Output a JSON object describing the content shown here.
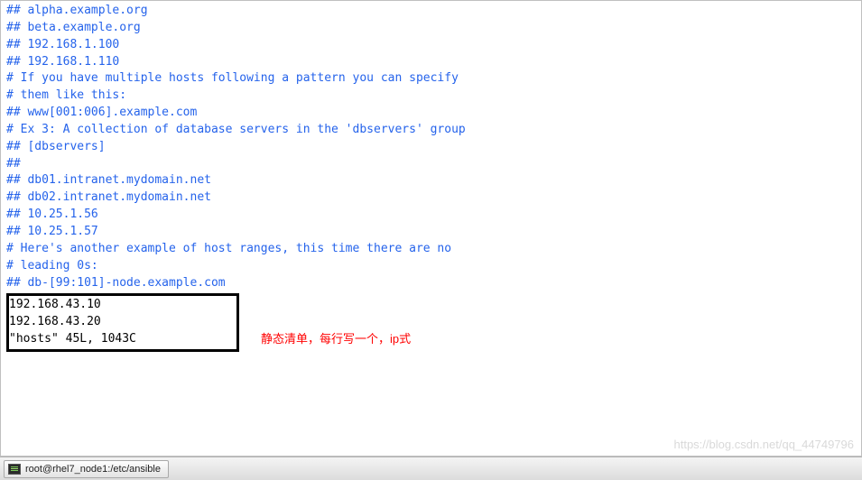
{
  "file_lines": [
    "## alpha.example.org",
    "## beta.example.org",
    "## 192.168.1.100",
    "## 192.168.1.110",
    "",
    "# If you have multiple hosts following a pattern you can specify",
    "# them like this:",
    "",
    "## www[001:006].example.com",
    "",
    "# Ex 3: A collection of database servers in the 'dbservers' group",
    "",
    "## [dbservers]",
    "##",
    "## db01.intranet.mydomain.net",
    "## db02.intranet.mydomain.net",
    "## 10.25.1.56",
    "## 10.25.1.57",
    "",
    "# Here's another example of host ranges, this time there are no",
    "# leading 0s:",
    "",
    "## db-[99:101]-node.example.com"
  ],
  "appended_lines": [
    "192.168.43.10",
    "192.168.43.20"
  ],
  "vim_status": "\"hosts\" 45L, 1043C",
  "annotation": "静态清单，每行写一个，ip式",
  "watermark": "https://blog.csdn.net/qq_44749796",
  "taskbar": {
    "task_label": "root@rhel7_node1:/etc/ansible"
  }
}
